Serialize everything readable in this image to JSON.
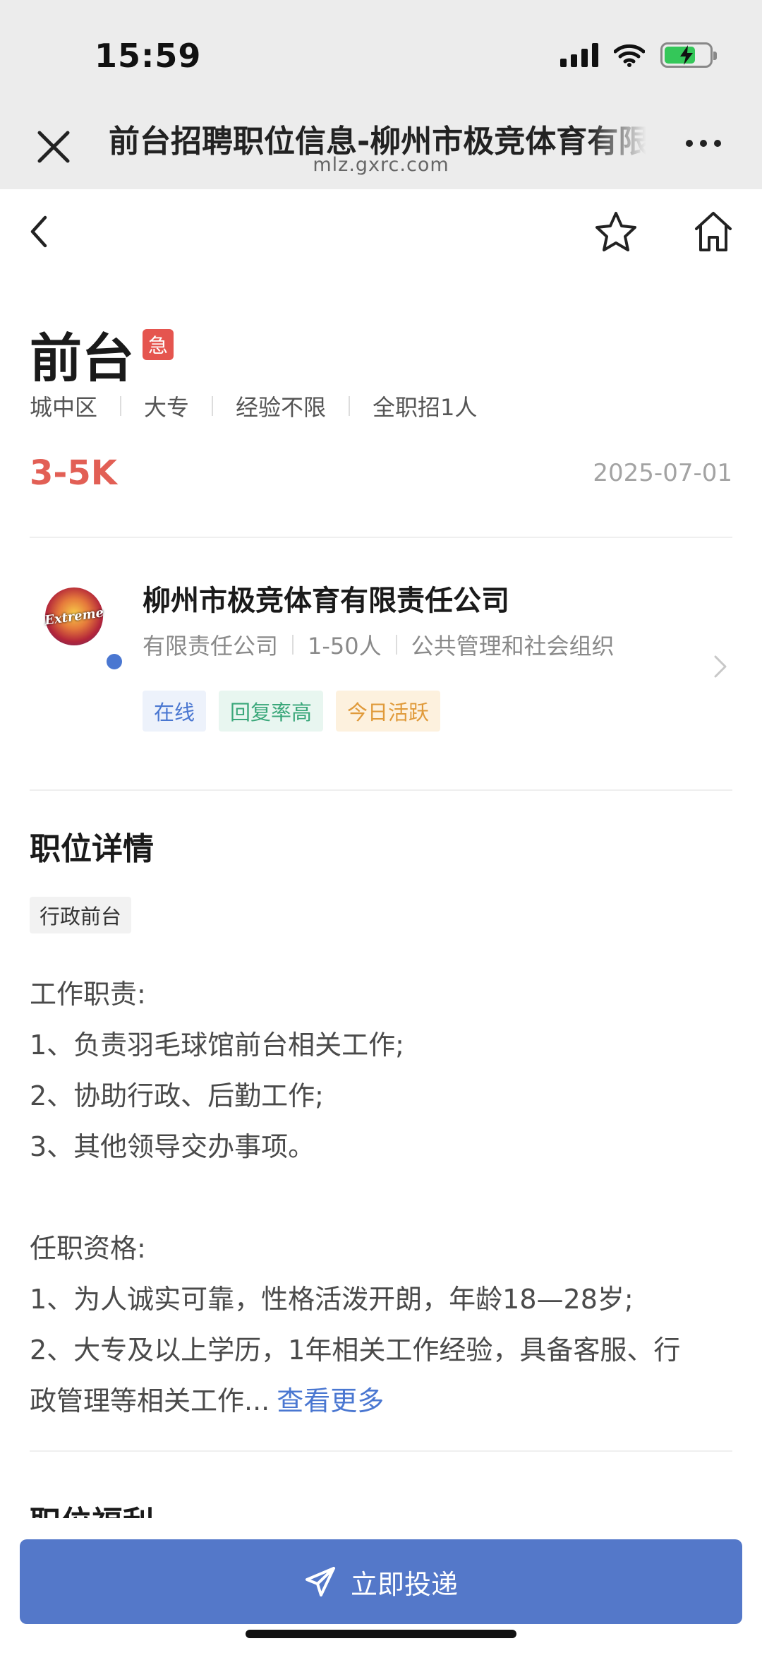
{
  "status_bar": {
    "time": "15:59"
  },
  "browser": {
    "title": "前台招聘职位信息-柳州市极竞体育有限责任公司",
    "url": "mlz.gxrc.com"
  },
  "job": {
    "title": "前台",
    "urgent_badge": "急",
    "meta": [
      "城中区",
      "大专",
      "经验不限",
      "全职招1人"
    ],
    "salary": "3-5K",
    "date": "2025-07-01"
  },
  "company": {
    "logo_text": "Extreme",
    "name": "柳州市极竞体育有限责任公司",
    "meta": [
      "有限责任公司",
      "1-50人",
      "公共管理和社会组织"
    ],
    "tags": [
      "在线",
      "回复率高",
      "今日活跃"
    ]
  },
  "details": {
    "section_title": "职位详情",
    "category_tag": "行政前台",
    "lines": [
      "工作职责:",
      "1、负责羽毛球馆前台相关工作;",
      "2、协助行政、后勤工作;",
      "3、其他领导交办事项。",
      "任职资格:",
      "1、为人诚实可靠，性格活泼开朗，年龄18—28岁;",
      "2、大专及以上学历，1年相关工作经验，具备客服、行",
      "政管理等相关工作..."
    ],
    "more_link": "查看更多"
  },
  "next_section_title": "职位福利",
  "apply_button": "立即投递",
  "colors": {
    "accent": "#5478c9",
    "salary": "#e25f55",
    "urgent": "#e5554f"
  }
}
